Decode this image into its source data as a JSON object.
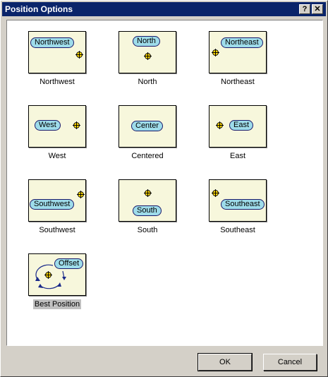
{
  "title": "Position Options",
  "title_buttons": {
    "help": "?",
    "close": "✕"
  },
  "items": [
    {
      "caption": "Northwest",
      "pill": "Northwest",
      "selected": false
    },
    {
      "caption": "North",
      "pill": "North",
      "selected": false
    },
    {
      "caption": "Northeast",
      "pill": "Northeast",
      "selected": false
    },
    {
      "caption": "West",
      "pill": "West",
      "selected": false
    },
    {
      "caption": "Centered",
      "pill": "Center",
      "selected": false
    },
    {
      "caption": "East",
      "pill": "East",
      "selected": false
    },
    {
      "caption": "Southwest",
      "pill": "Southwest",
      "selected": false
    },
    {
      "caption": "South",
      "pill": "South",
      "selected": false
    },
    {
      "caption": "Southeast",
      "pill": "Southeast",
      "selected": false
    },
    {
      "caption": "Best Position",
      "pill": "Offset",
      "selected": true
    }
  ],
  "buttons": {
    "ok": "OK",
    "cancel": "Cancel"
  },
  "colors": {
    "title_bar": "#0a246a",
    "thumb_bg": "#f7f7dc",
    "pill": "#9edcea",
    "target": "#ffd800"
  }
}
